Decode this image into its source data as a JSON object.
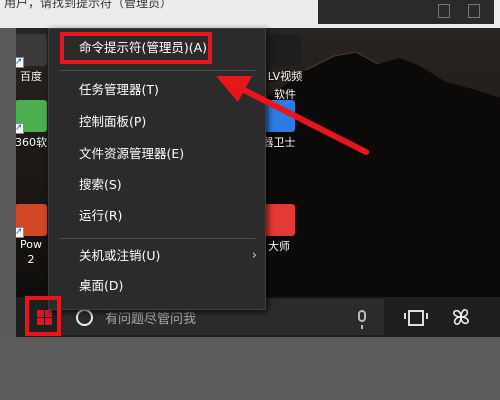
{
  "top_strip": {
    "cut_text": "用户，请找到提示符（管理员）"
  },
  "desktop_icons": [
    {
      "name": "baidu",
      "label": "百度"
    },
    {
      "name": "360",
      "label": "360软"
    },
    {
      "name": "powerpoint",
      "label": "Pow",
      "label2": "2"
    },
    {
      "name": "lv-video",
      "label": "LV视频",
      "label2": "软件"
    },
    {
      "name": "guard",
      "label": "器卫士"
    },
    {
      "name": "master",
      "label": "大师"
    }
  ],
  "context_menu": {
    "items": [
      {
        "label": "命令提示符(管理员)(A)"
      },
      {
        "label": "任务管理器(T)"
      },
      {
        "label": "控制面板(P)"
      },
      {
        "label": "文件资源管理器(E)"
      },
      {
        "label": "搜索(S)"
      },
      {
        "label": "运行(R)"
      },
      {
        "label": "关机或注销(U)",
        "submenu": true
      },
      {
        "label": "桌面(D)"
      }
    ]
  },
  "taskbar": {
    "search_placeholder": "有问题尽管问我"
  },
  "colors": {
    "highlight": "#e8161b",
    "menu_bg": "#2b2b2b",
    "taskbar_bg": "#1f1f1f",
    "start_logo": "#e81123"
  },
  "icons": [
    "windows-logo-icon",
    "cortana-icon",
    "microphone-icon",
    "task-view-icon",
    "pinwheel-icon",
    "chevron-right-icon",
    "shortcut-arrow-icon"
  ]
}
